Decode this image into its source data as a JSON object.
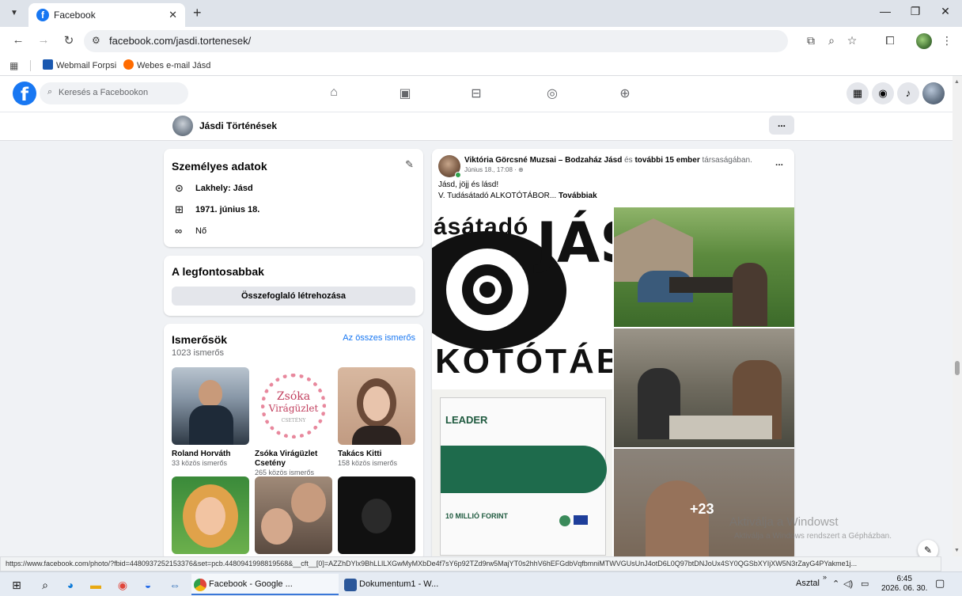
{
  "browser": {
    "tab_title": "Facebook",
    "tab_close": "✕",
    "new_tab": "+",
    "url": "facebook.com/jasdi.tortenesek/",
    "bookmarks": [
      {
        "label": "Webmail Forpsi",
        "color": "#1a58b0"
      },
      {
        "label": "Webes e-mail Jásd",
        "color": "#ff6b00"
      }
    ],
    "status_url": "https://www.facebook.com/photo/?fbid=4480937252153376&set=pcb.4480941998819568&__cft__[0]=AZZhDYlx9BhLLlLXGwMyMXbDe4f7sY6p92TZd9rw5MajYT0s2hhV6hEFGdbVqfbmniMTWVGUsUnJ4otD6L0Q97btDNJoUx4SY0QGSbXYIjXW5N3rZayG4PYakme1j..."
  },
  "facebook": {
    "brand_color": "#1877f2",
    "search_placeholder": "Keresés a Facebookon",
    "page_name": "Jásdi Történések",
    "more_label": "...",
    "personal": {
      "title": "Személyes adatok",
      "rows": [
        {
          "icon": "location-pin-icon",
          "text": "Lakhely: Jásd"
        },
        {
          "icon": "birthday-cake-icon",
          "text": "1971. június 18."
        },
        {
          "icon": "gender-icon",
          "text": "Nő"
        }
      ]
    },
    "highlights": {
      "title": "A legfontosabbak",
      "button": "Összefoglaló létrehozása"
    },
    "friends": {
      "title": "Ismerősök",
      "count": "1023 ismerős",
      "see_all": "Az összes ismerős",
      "list": [
        {
          "name": "Roland Horváth",
          "mutual": "33 közös ismerős"
        },
        {
          "name": "Zsóka Virágüzlet Csetény",
          "mutual": "265 közös ismerős"
        },
        {
          "name": "Takács Kitti",
          "mutual": "158 közös ismerős"
        }
      ],
      "zsoka_logo_line1": "Zsóka",
      "zsoka_logo_line2": "Virágüzlet",
      "zsoka_logo_line3": "CSETÉNY"
    },
    "post": {
      "author": "Viktória Görcsné Muzsai",
      "dash": " – ",
      "with": "Bodzaház Jásd",
      "and": " és ",
      "others": "további 15 ember",
      "company": " társaságában.",
      "time": "Június 18., 17:08 · ",
      "more": "...",
      "line1": "Jásd, jöjj és lásd!",
      "line2": "V. Tudásátadó ALKOTÓTÁBOR...",
      "see_more": "Továbbiak",
      "poster_top": "ásátadó",
      "poster_jas": "JÁS",
      "poster_bottom": "KOTÓTÁB",
      "leader": "LEADER",
      "leader_sub": "10 MILLIÓ FORINT",
      "extra_count": "+23"
    }
  },
  "windows": {
    "watermark_title": "Aktiválja a Windowst",
    "watermark_sub": "Aktiválja a Windows rendszert a Gépházban.",
    "taskbar_apps": [
      {
        "label": "Facebook - Google ...",
        "active": true
      },
      {
        "label": "Dokumentum1 - W...",
        "active": false
      }
    ],
    "tray_desktop": "Asztal",
    "tray_chevron": "»",
    "time": "6:45",
    "date": "2026. 06. 30."
  }
}
